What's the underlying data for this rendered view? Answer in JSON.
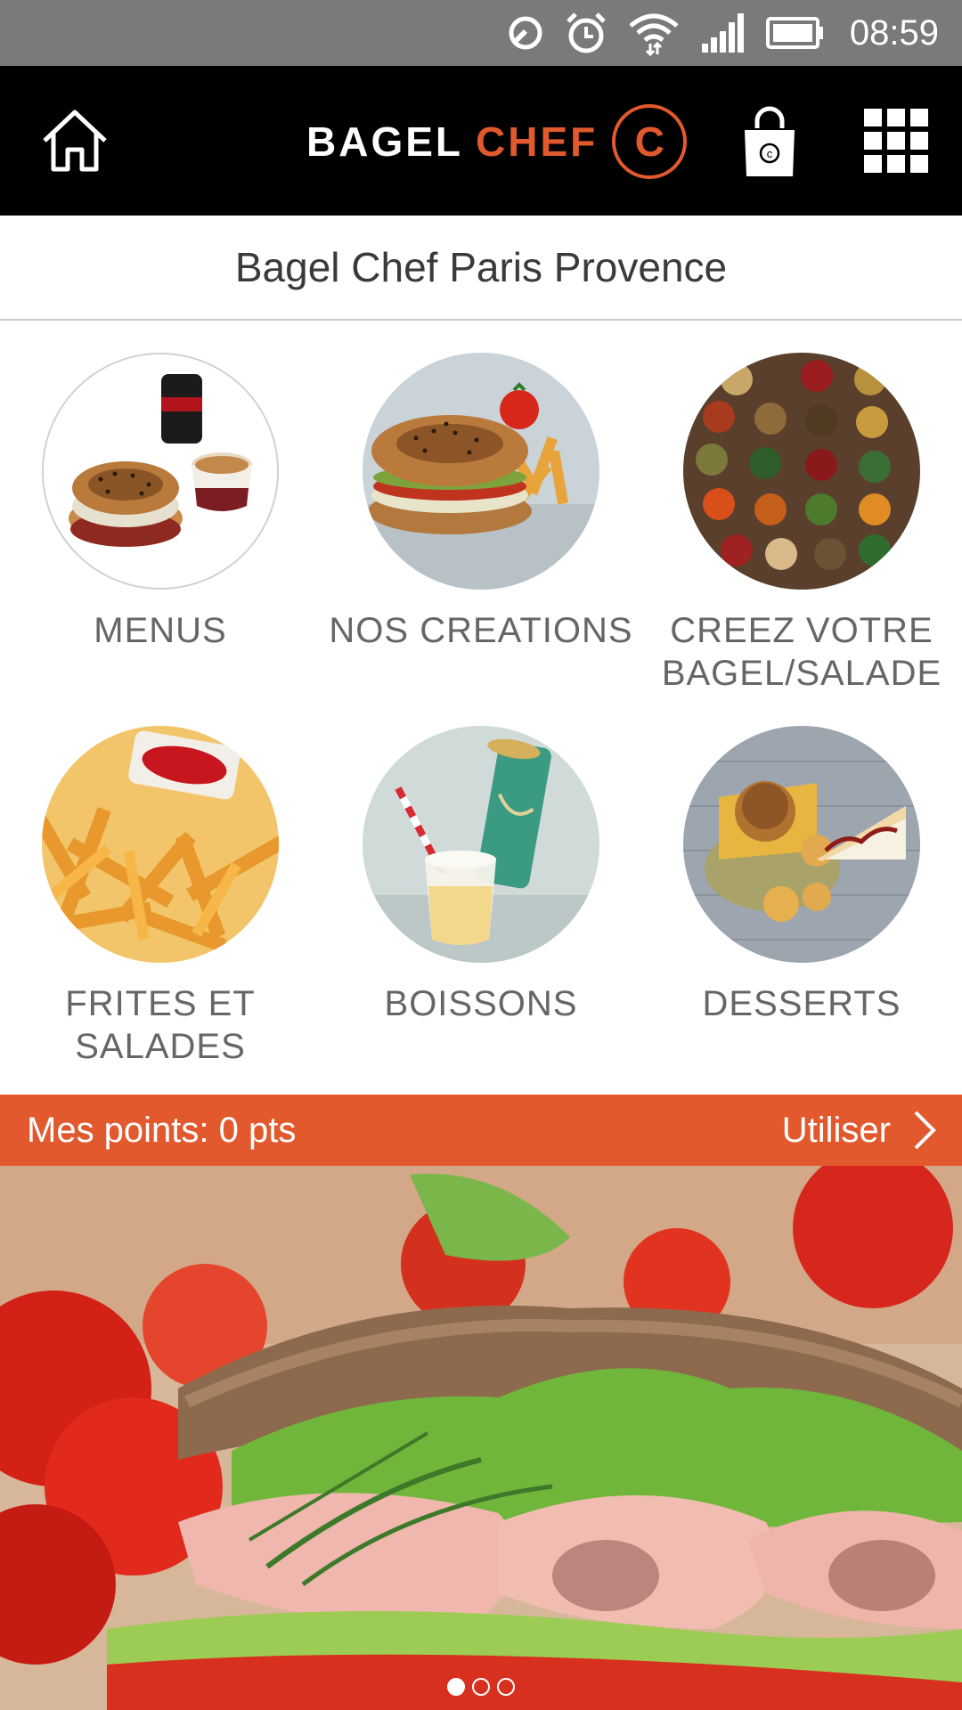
{
  "status_bar": {
    "time": "08:59",
    "icons": [
      "sync-icon",
      "alarm-icon",
      "wifi-icon",
      "signal-icon",
      "battery-icon"
    ]
  },
  "header": {
    "logo_part1": "BAGEL",
    "logo_part2": "CHEF",
    "logo_mark": "C",
    "cart_badge": "c",
    "icons": [
      "home-icon",
      "shopping-bag-icon",
      "grid-menu-icon"
    ],
    "accent_color": "#e2592d"
  },
  "store": {
    "title": "Bagel Chef Paris Provence"
  },
  "categories": [
    {
      "label": "MENUS"
    },
    {
      "label": "NOS CREATIONS"
    },
    {
      "label_line1": "CREEZ VOTRE",
      "label_line2": "BAGEL/SALADE"
    },
    {
      "label_line1": "FRITES ET",
      "label_line2": "SALADES"
    },
    {
      "label": "BOISSONS"
    },
    {
      "label": "DESSERTS"
    }
  ],
  "points": {
    "label": "Mes points: 0 pts",
    "action": "Utiliser"
  },
  "carousel": {
    "active_index": 0,
    "total": 3
  }
}
